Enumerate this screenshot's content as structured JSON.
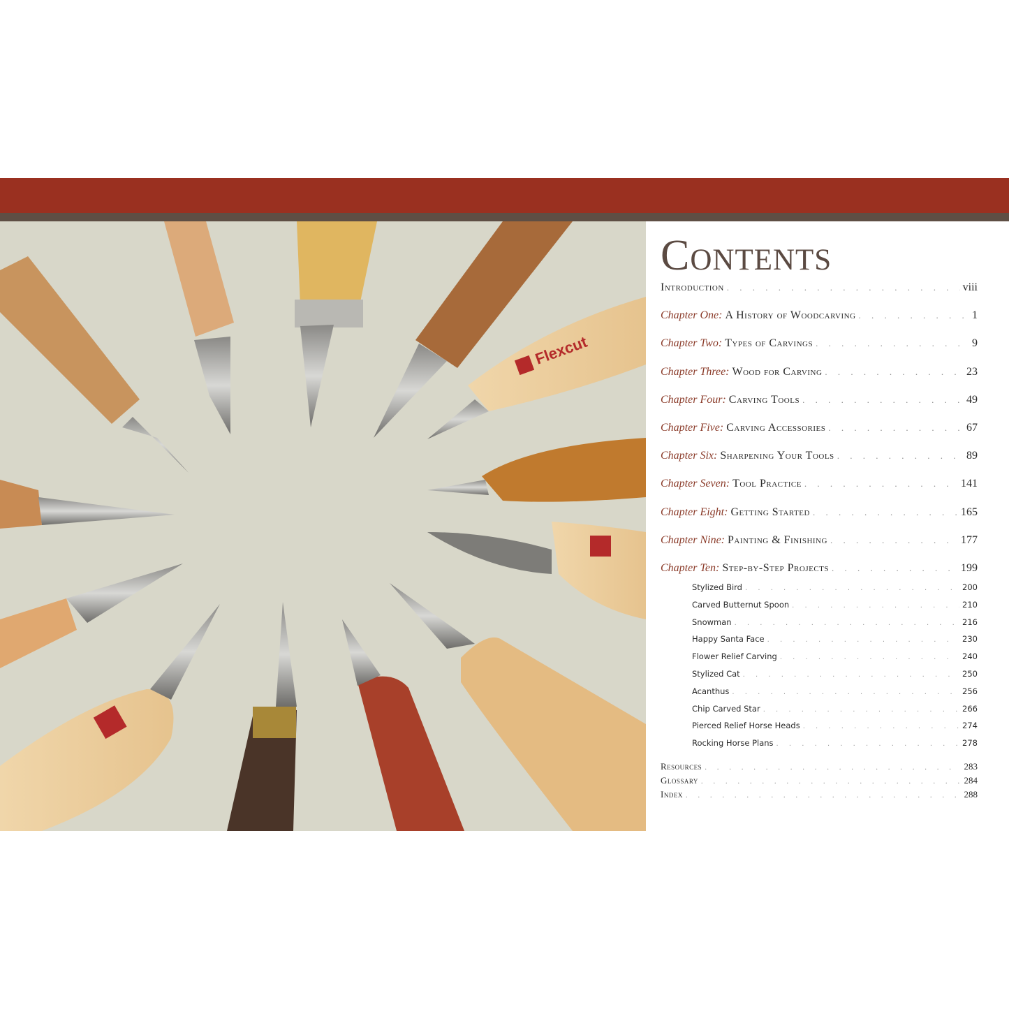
{
  "colors": {
    "band": "#9a3020",
    "rule": "#5e4e44",
    "accent": "#8a3a28",
    "photo_bg": "#d8d7c9"
  },
  "photo": {
    "handle_brand": "Flexcut"
  },
  "toc": {
    "title": "Contents",
    "dots": ". . . . . . . . . . . . . . . . . . . . . . . . . . . . . . . . . . . . . . . . . . . . . . . . . . . .",
    "entries": [
      {
        "prefix": "",
        "title": "Introduction",
        "page": "viii"
      },
      {
        "prefix": "Chapter One:",
        "title": "A History of Woodcarving",
        "page": "1"
      },
      {
        "prefix": "Chapter Two:",
        "title": "Types of Carvings",
        "page": "9"
      },
      {
        "prefix": "Chapter Three:",
        "title": "Wood for Carving",
        "page": "23"
      },
      {
        "prefix": "Chapter Four:",
        "title": "Carving Tools",
        "page": "49"
      },
      {
        "prefix": "Chapter Five:",
        "title": "Carving Accessories",
        "page": "67"
      },
      {
        "prefix": "Chapter Six:",
        "title": "Sharpening Your Tools",
        "page": "89"
      },
      {
        "prefix": "Chapter Seven:",
        "title": "Tool Practice",
        "page": "141"
      },
      {
        "prefix": "Chapter Eight:",
        "title": "Getting Started",
        "page": "165"
      },
      {
        "prefix": "Chapter Nine:",
        "title": "Painting & Finishing",
        "page": "177"
      },
      {
        "prefix": "Chapter Ten:",
        "title": "Step-by-Step Projects",
        "page": "199"
      }
    ],
    "projects": [
      {
        "title": "Stylized Bird",
        "page": "200"
      },
      {
        "title": "Carved Butternut Spoon",
        "page": "210"
      },
      {
        "title": "Snowman",
        "page": "216"
      },
      {
        "title": "Happy Santa Face",
        "page": "230"
      },
      {
        "title": "Flower Relief Carving",
        "page": "240"
      },
      {
        "title": "Stylized Cat",
        "page": "250"
      },
      {
        "title": "Acanthus",
        "page": "256"
      },
      {
        "title": "Chip Carved Star",
        "page": "266"
      },
      {
        "title": "Pierced Relief Horse Heads",
        "page": "274"
      },
      {
        "title": "Rocking Horse Plans",
        "page": "278"
      }
    ],
    "back_matter": [
      {
        "title": "Resources",
        "page": "283"
      },
      {
        "title": "Glossary",
        "page": "284"
      },
      {
        "title": "Index",
        "page": "288"
      }
    ]
  }
}
